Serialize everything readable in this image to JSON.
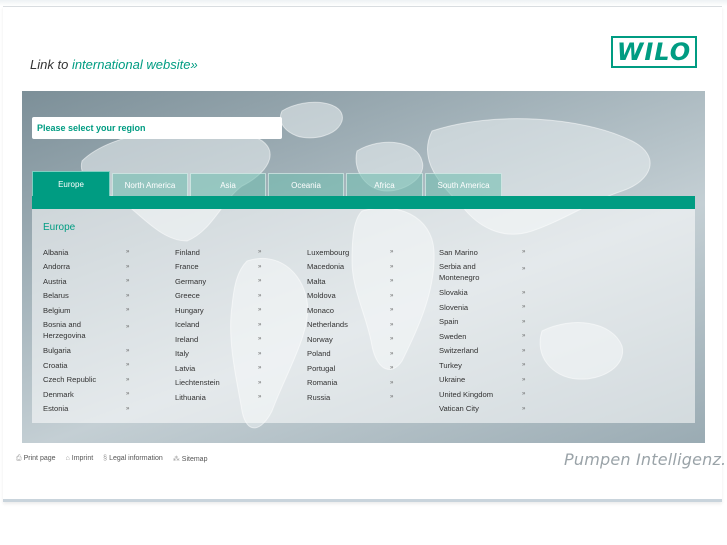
{
  "header": {
    "link_prefix": "Link to",
    "link_text": "international website",
    "link_suffix": "»",
    "logo_text": "WILO"
  },
  "region_selector": {
    "label": "Please select your region"
  },
  "tabs": [
    {
      "label": "Europe",
      "active": true
    },
    {
      "label": "North America",
      "active": false
    },
    {
      "label": "Asia",
      "active": false
    },
    {
      "label": "Oceania",
      "active": false
    },
    {
      "label": "Africa",
      "active": false
    },
    {
      "label": "South America",
      "active": false
    }
  ],
  "panel": {
    "title": "Europe",
    "columns": [
      [
        "Albania",
        "Andorra",
        "Austria",
        "Belarus",
        "Belgium",
        "Bosnia and Herzegovina",
        "Bulgaria",
        "Croatia",
        "Czech Republic",
        "Denmark",
        "Estonia"
      ],
      [
        "Finland",
        "France",
        "Germany",
        "Greece",
        "Hungary",
        "Iceland",
        "Ireland",
        "Italy",
        "Latvia",
        "Liechtenstein",
        "Lithuania"
      ],
      [
        "Luxembourg",
        "Macedonia",
        "Malta",
        "Moldova",
        "Monaco",
        "Netherlands",
        "Norway",
        "Poland",
        "Portugal",
        "Romania",
        "Russia"
      ],
      [
        "San Marino",
        "Serbia and Montenegro",
        "Slovakia",
        "Slovenia",
        "Spain",
        "Sweden",
        "Switzerland",
        "Turkey",
        "Ukraine",
        "United Kingdom",
        "Vatican City"
      ]
    ],
    "arrow": "»"
  },
  "footer": {
    "links": [
      {
        "icon": "print-icon",
        "glyph": "⎙",
        "label": "Print page"
      },
      {
        "icon": "imprint-icon",
        "glyph": "⌂",
        "label": "Imprint"
      },
      {
        "icon": "legal-icon",
        "glyph": "§",
        "label": "Legal information"
      },
      {
        "icon": "sitemap-icon",
        "glyph": "⁂",
        "label": "Sitemap"
      }
    ],
    "slogan": "Pumpen Intelligenz."
  },
  "colors": {
    "brand": "#009c82"
  }
}
